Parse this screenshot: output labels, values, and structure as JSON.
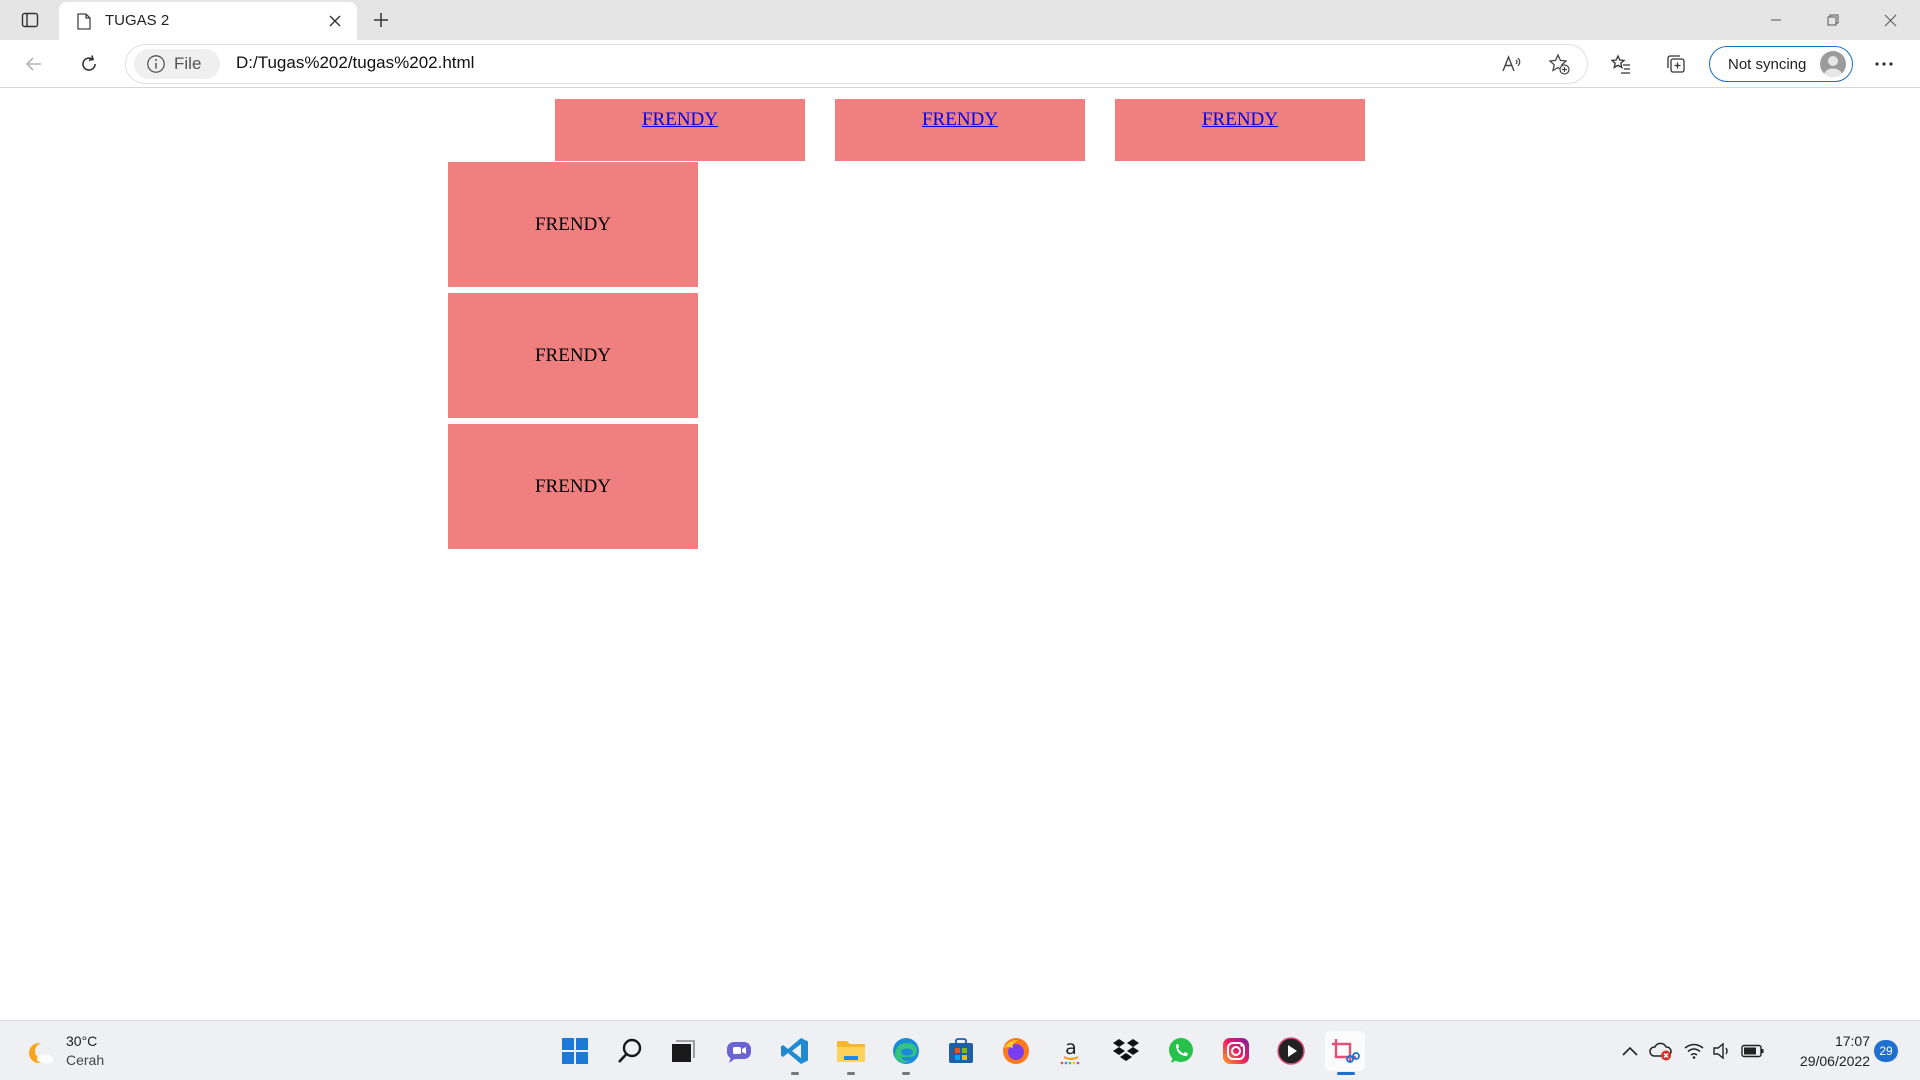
{
  "browser": {
    "tab": {
      "title": "TUGAS 2"
    },
    "address": {
      "scheme_label": "File",
      "url": "D:/Tugas%202/tugas%202.html"
    },
    "sync_label": "Not syncing"
  },
  "page": {
    "nav_links": [
      "FRENDY",
      "FRENDY",
      "FRENDY"
    ],
    "side_boxes": [
      "FRENDY",
      "FRENDY",
      "FRENDY"
    ],
    "box_color": "#f08080",
    "link_color": "#0000ee"
  },
  "taskbar": {
    "weather": {
      "temp": "30°C",
      "condition": "Cerah"
    },
    "apps": [
      "start-icon",
      "search-icon",
      "task-view-icon",
      "chat-icon",
      "vscode-icon",
      "file-explorer-icon",
      "edge-icon",
      "store-icon",
      "firefox-icon",
      "amazon-icon",
      "dropbox-icon",
      "whatsapp-icon",
      "instagram-icon",
      "media-player-icon",
      "snipping-tool-icon"
    ],
    "clock": {
      "time": "17:07",
      "date": "29/06/2022"
    },
    "notification_count": "29"
  }
}
